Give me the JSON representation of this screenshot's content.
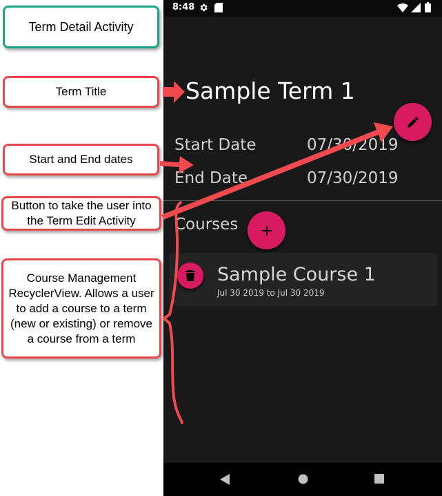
{
  "annotations": {
    "term_detail_activity": "Term Detail Activity",
    "term_title": "Term Title",
    "start_end_dates": "Start and End dates",
    "edit_button": "Button to take the user into the Term Edit Activity",
    "course_management": "Course Management RecyclerView.  Allows a user to add a course to a term (new or existing) or remove a course from a term"
  },
  "status_bar": {
    "time": "8:48"
  },
  "term": {
    "title": "Sample Term 1",
    "start_label": "Start Date",
    "start_value": "07/30/2019",
    "end_label": "End Date",
    "end_value": "07/30/2019"
  },
  "courses": {
    "label": "Courses",
    "items": [
      {
        "title": "Sample Course 1",
        "dates": "Jul 30 2019 to Jul 30 2019"
      }
    ]
  },
  "colors": {
    "accent": "#d81b60",
    "callout_border": "#e8474c",
    "callout_teal": "#1aa58a",
    "background": "#191919"
  }
}
